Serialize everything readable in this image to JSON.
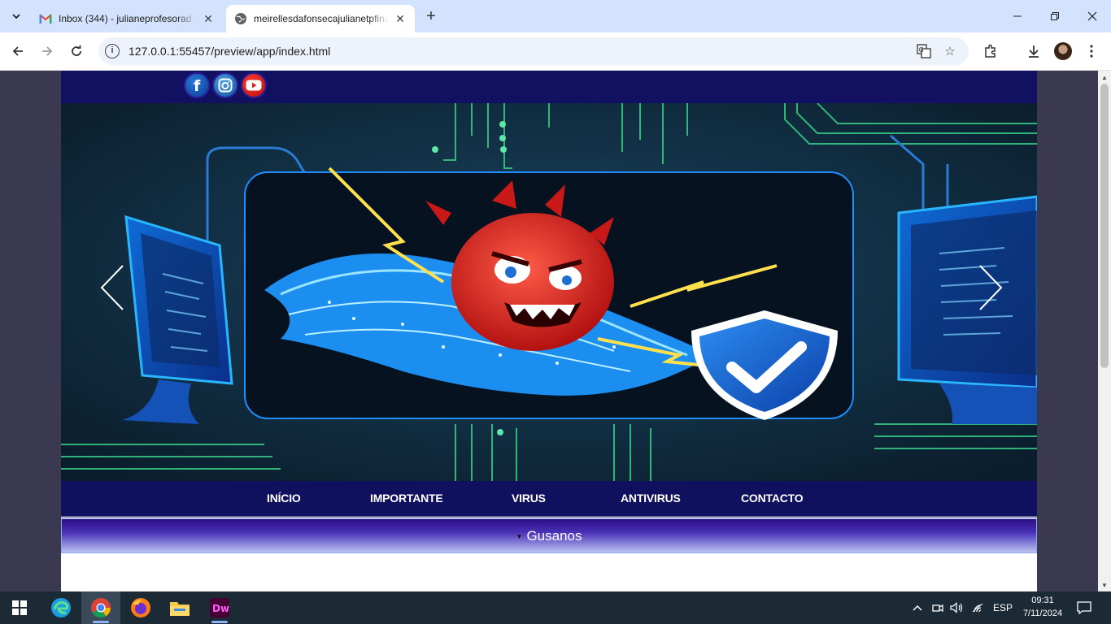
{
  "browser": {
    "tabs": [
      {
        "title": "Inbox (344) - julianeprofesorad",
        "favicon": "gmail-icon",
        "active": false
      },
      {
        "title": "meirellesdafonsecajulianetpfina",
        "favicon": "globe-icon",
        "active": true
      }
    ],
    "url": "127.0.0.1:55457/preview/app/index.html"
  },
  "site": {
    "social": [
      "facebook",
      "instagram",
      "youtube"
    ],
    "social_glyphs": {
      "facebook": "f",
      "instagram": "◎",
      "youtube": "▶"
    },
    "menu": [
      "INÍCIO",
      "IMPORTANTE",
      "VIRUS",
      "ANTIVIRUS",
      "CONTACTO"
    ],
    "accordion_title": "Gusanos",
    "colors": {
      "nav": "#10115e",
      "topbar": "#121161",
      "accent": "#4a32b8"
    }
  },
  "taskbar": {
    "apps": [
      "windows-start",
      "edge",
      "chrome",
      "firefox",
      "file-explorer",
      "dreamweaver"
    ],
    "dreamweaver_label": "Dw",
    "language": "ESP",
    "time": "09:31",
    "date": "7/11/2024"
  }
}
